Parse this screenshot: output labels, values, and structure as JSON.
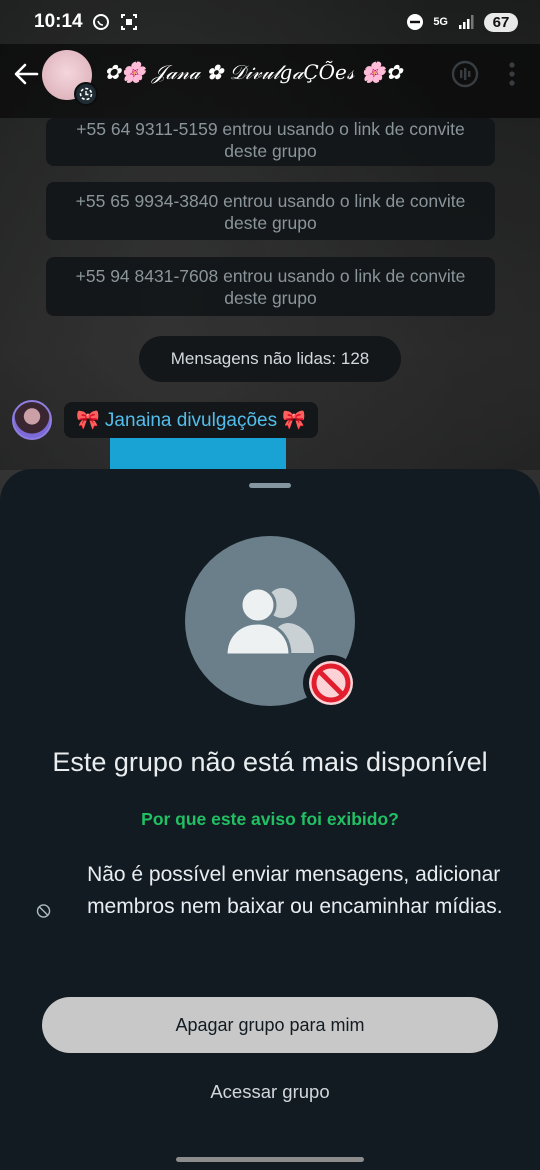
{
  "status_bar": {
    "time": "10:14",
    "network": "5G",
    "battery": "67",
    "icons": [
      "whatsapp-status-icon",
      "screenshot-icon",
      "do-not-disturb-icon",
      "signal-icon"
    ]
  },
  "header": {
    "title": "✿🌸 𝒥𝒶𝓃𝒶 ✿ 𝒟𝒾𝓋𝓊𝓁𝑔𝒶ÇÕ𝑒𝓈 🌸✿",
    "icons": [
      "back-arrow-icon",
      "group-avatar",
      "call-icon",
      "more-vert-icon"
    ]
  },
  "chat": {
    "system_messages": [
      "+55 64 9311-5159 entrou usando o link de convite deste grupo",
      "+55 65 9934-3840 entrou usando o link de convite deste grupo",
      "+55 94 8431-7608 entrou usando o link de convite deste grupo"
    ],
    "unread_label": "Mensagens não lidas: 128",
    "sender_name": "🎀 Janaina divulgações 🎀"
  },
  "sheet": {
    "title": "Este grupo não está mais disponível",
    "why_link": "Por que este aviso foi exibido?",
    "info_text": "Não é possível enviar mensagens, adicionar membros nem baixar ou encaminhar mídias.",
    "primary_button": "Apagar grupo para mim",
    "secondary_button": "Acessar grupo"
  },
  "colors": {
    "sheet_bg": "#121b22",
    "accent_green": "#21c063",
    "link_blue": "#53bdeb",
    "ban_red": "#e11d2e",
    "avatar_gray": "#6a7f8a"
  }
}
